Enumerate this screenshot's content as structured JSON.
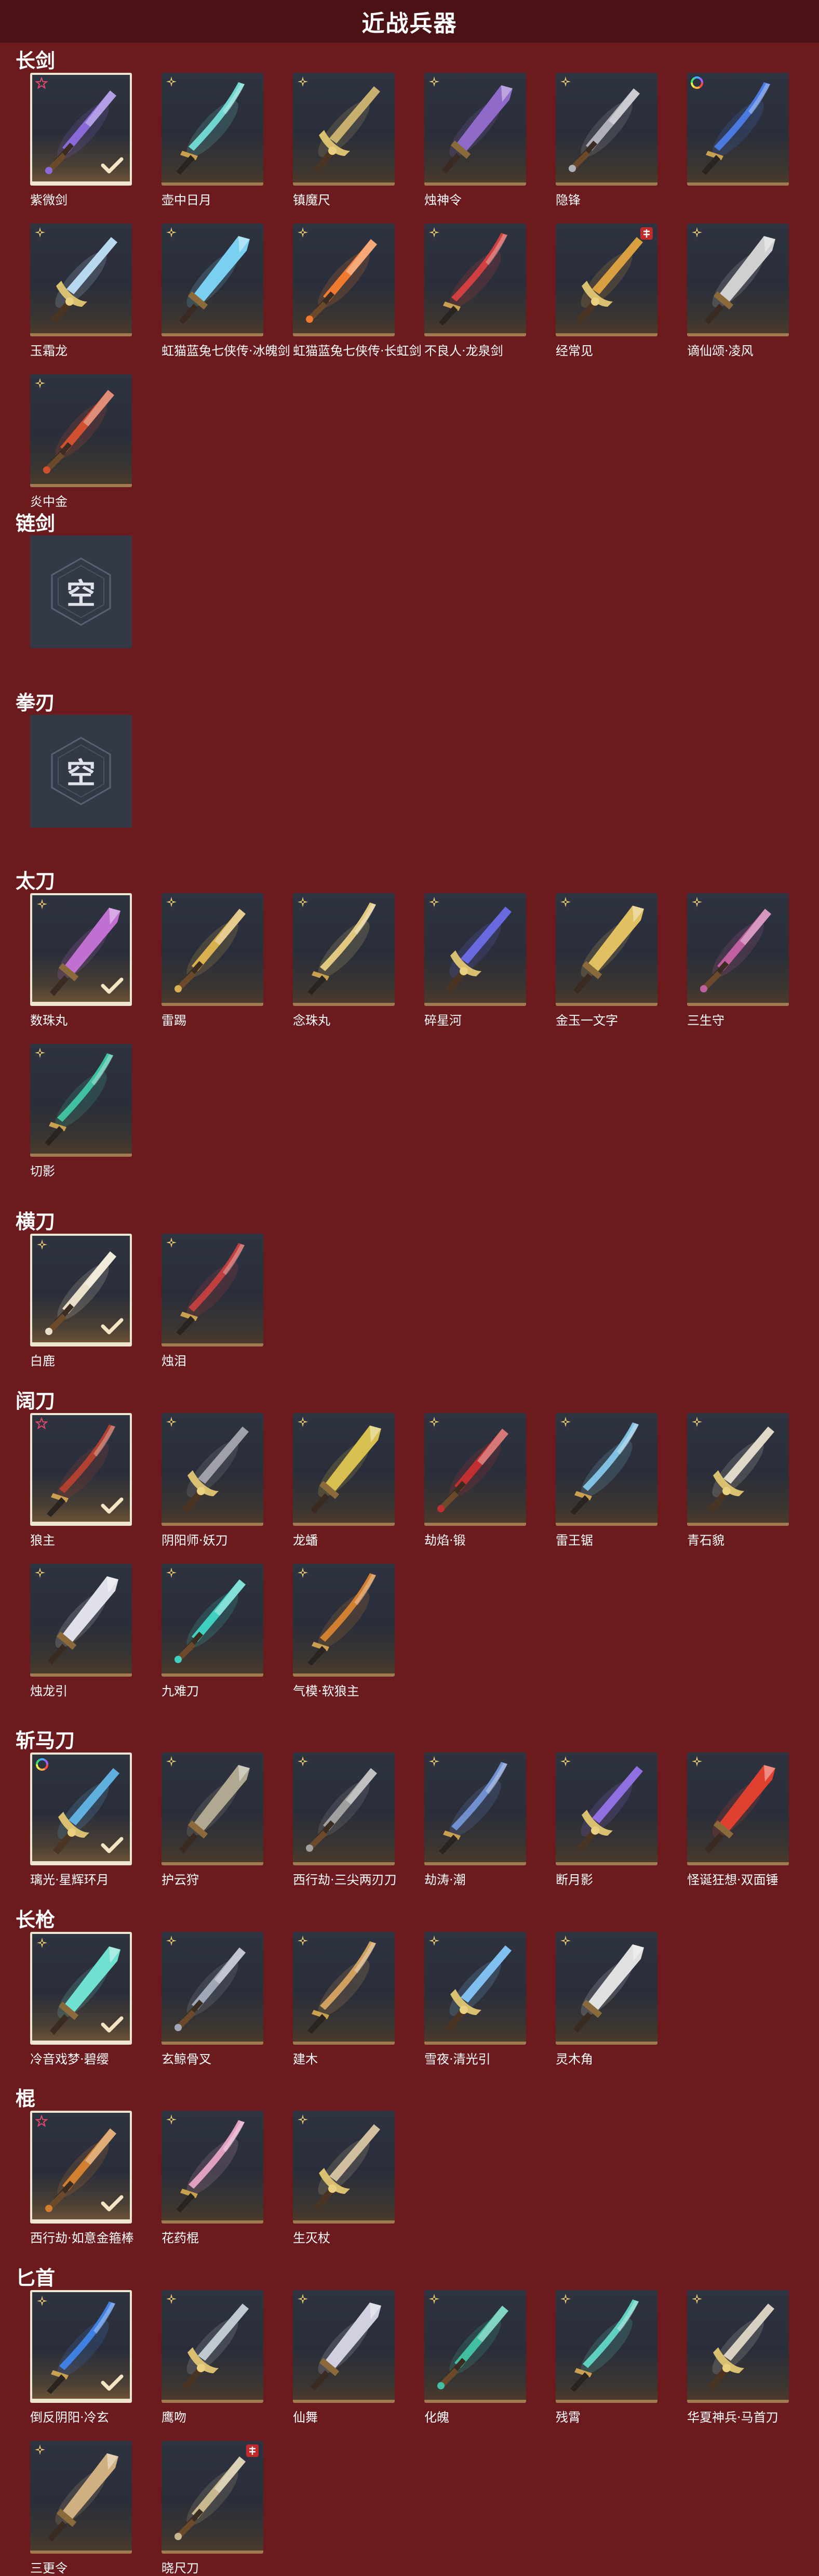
{
  "page_title": "近战兵器",
  "empty_text": "空",
  "sections": [
    {
      "title": "长剑",
      "items": [
        {
          "name": "紫微剑",
          "owned": true,
          "badge": "star",
          "color": "#8a6ad8"
        },
        {
          "name": "壶中日月",
          "owned": false,
          "badge": "cross",
          "color": "#6fd6d0"
        },
        {
          "name": "镇魔尺",
          "owned": false,
          "badge": "cross",
          "color": "#c8b070"
        },
        {
          "name": "烛神令",
          "owned": false,
          "badge": "cross",
          "color": "#8f6ac8"
        },
        {
          "name": "隐锋",
          "owned": false,
          "badge": "cross",
          "color": "#b0b0b8"
        },
        {
          "name": "",
          "owned": false,
          "badge": "ring",
          "color": "#4a7ae0"
        },
        {
          "name": "玉霜龙",
          "owned": false,
          "badge": "cross",
          "color": "#b8d8f0"
        },
        {
          "name": "虹猫蓝兔七侠传·冰魄剑",
          "owned": false,
          "badge": "cross",
          "color": "#7ad0f0"
        },
        {
          "name": "虹猫蓝兔七侠传·长虹剑",
          "owned": false,
          "badge": "cross",
          "color": "#f07a30"
        },
        {
          "name": "不良人·龙泉剑",
          "owned": false,
          "badge": "cross",
          "color": "#d04040"
        },
        {
          "name": "经常见",
          "owned": false,
          "badge": "seal",
          "color": "#d8a040"
        },
        {
          "name": "谪仙颂·凌风",
          "owned": false,
          "badge": "cross",
          "color": "#d0d0d0"
        },
        {
          "name": "炎中金",
          "owned": false,
          "badge": "cross",
          "color": "#d05030"
        }
      ]
    },
    {
      "title": "链剑",
      "items": []
    },
    {
      "title": "拳刃",
      "items": []
    },
    {
      "title": "太刀",
      "items": [
        {
          "name": "数珠丸",
          "owned": true,
          "badge": "cross",
          "color": "#c070d0"
        },
        {
          "name": "雷踢",
          "owned": false,
          "badge": "cross",
          "color": "#d8b050"
        },
        {
          "name": "念珠丸",
          "owned": false,
          "badge": "cross",
          "color": "#e0c880"
        },
        {
          "name": "碎星河",
          "owned": false,
          "badge": "cross",
          "color": "#6a6ae0"
        },
        {
          "name": "金玉一文字",
          "owned": false,
          "badge": "cross",
          "color": "#e0c060"
        },
        {
          "name": "三生守",
          "owned": false,
          "badge": "cross",
          "color": "#c060a0"
        },
        {
          "name": "切影",
          "owned": false,
          "badge": "cross",
          "color": "#40c0a0"
        }
      ]
    },
    {
      "title": "横刀",
      "items": [
        {
          "name": "白鹿",
          "owned": true,
          "badge": "cross",
          "color": "#e8e0c8"
        },
        {
          "name": "烛泪",
          "owned": false,
          "badge": "cross",
          "color": "#c04040"
        }
      ]
    },
    {
      "title": "阔刀",
      "items": [
        {
          "name": "狼主",
          "owned": true,
          "badge": "star",
          "color": "#b04030"
        },
        {
          "name": "阴阳师·妖刀",
          "owned": false,
          "badge": "cross",
          "color": "#a0a0a8"
        },
        {
          "name": "龙蟠",
          "owned": false,
          "badge": "cross",
          "color": "#d8c050"
        },
        {
          "name": "劫焰·锻",
          "owned": false,
          "badge": "cross",
          "color": "#c03030"
        },
        {
          "name": "雷王锯",
          "owned": false,
          "badge": "cross",
          "color": "#80c0e0"
        },
        {
          "name": "青石貌",
          "owned": false,
          "badge": "cross",
          "color": "#e0d8c8"
        },
        {
          "name": "烛龙引",
          "owned": false,
          "badge": "cross",
          "color": "#e0e0e8"
        },
        {
          "name": "九难刀",
          "owned": false,
          "badge": "cross",
          "color": "#40d0c0"
        },
        {
          "name": "气模·软狼主",
          "owned": false,
          "badge": "cross",
          "color": "#d08030"
        }
      ]
    },
    {
      "title": "斩马刀",
      "items": [
        {
          "name": "璃光·星辉环月",
          "owned": true,
          "badge": "ring",
          "color": "#60b0e0"
        },
        {
          "name": "护云狩",
          "owned": false,
          "badge": "cross",
          "color": "#b0a890"
        },
        {
          "name": "西行劫·三尖两刃刀",
          "owned": false,
          "badge": "cross",
          "color": "#a0a0a0"
        },
        {
          "name": "劫涛·潮",
          "owned": false,
          "badge": "cross",
          "color": "#7090d0"
        },
        {
          "name": "断月影",
          "owned": false,
          "badge": "cross",
          "color": "#9070e0"
        },
        {
          "name": "怪诞狂想·双面锤",
          "owned": false,
          "badge": "cross",
          "color": "#e04030"
        }
      ]
    },
    {
      "title": "长枪",
      "items": [
        {
          "name": "冷音戏梦·碧缨",
          "owned": true,
          "badge": "cross",
          "color": "#70e0d0"
        },
        {
          "name": "玄鲸骨叉",
          "owned": false,
          "badge": "cross",
          "color": "#a0a8b8"
        },
        {
          "name": "建木",
          "owned": false,
          "badge": "cross",
          "color": "#d0a060"
        },
        {
          "name": "雪夜·清光引",
          "owned": false,
          "badge": "cross",
          "color": "#80c0f0"
        },
        {
          "name": "灵木角",
          "owned": false,
          "badge": "cross",
          "color": "#e0e0e0"
        }
      ]
    },
    {
      "title": "棍",
      "items": [
        {
          "name": "西行劫·如意金箍棒",
          "owned": true,
          "badge": "star",
          "color": "#d08030"
        },
        {
          "name": "花药棍",
          "owned": false,
          "badge": "cross",
          "color": "#e0a0c0"
        },
        {
          "name": "生灭杖",
          "owned": false,
          "badge": "cross",
          "color": "#d0c0a0"
        }
      ]
    },
    {
      "title": "匕首",
      "items": [
        {
          "name": "倒反阴阳·冷玄",
          "owned": true,
          "badge": "cross",
          "color": "#4080e0"
        },
        {
          "name": "鹰吻",
          "owned": false,
          "badge": "cross",
          "color": "#c0c8d0"
        },
        {
          "name": "仙舞",
          "owned": false,
          "badge": "cross",
          "color": "#d0d0e0"
        },
        {
          "name": "化魄",
          "owned": false,
          "badge": "cross",
          "color": "#40c0a0"
        },
        {
          "name": "残霄",
          "owned": false,
          "badge": "cross",
          "color": "#60d0c0"
        },
        {
          "name": "华夏神兵·马首刀",
          "owned": false,
          "badge": "cross",
          "color": "#d8d0c0"
        },
        {
          "name": "三更令",
          "owned": false,
          "badge": "cross",
          "color": "#d0b080"
        },
        {
          "name": "晓尺刀",
          "owned": false,
          "badge": "seal",
          "color": "#c8b890"
        }
      ]
    }
  ]
}
